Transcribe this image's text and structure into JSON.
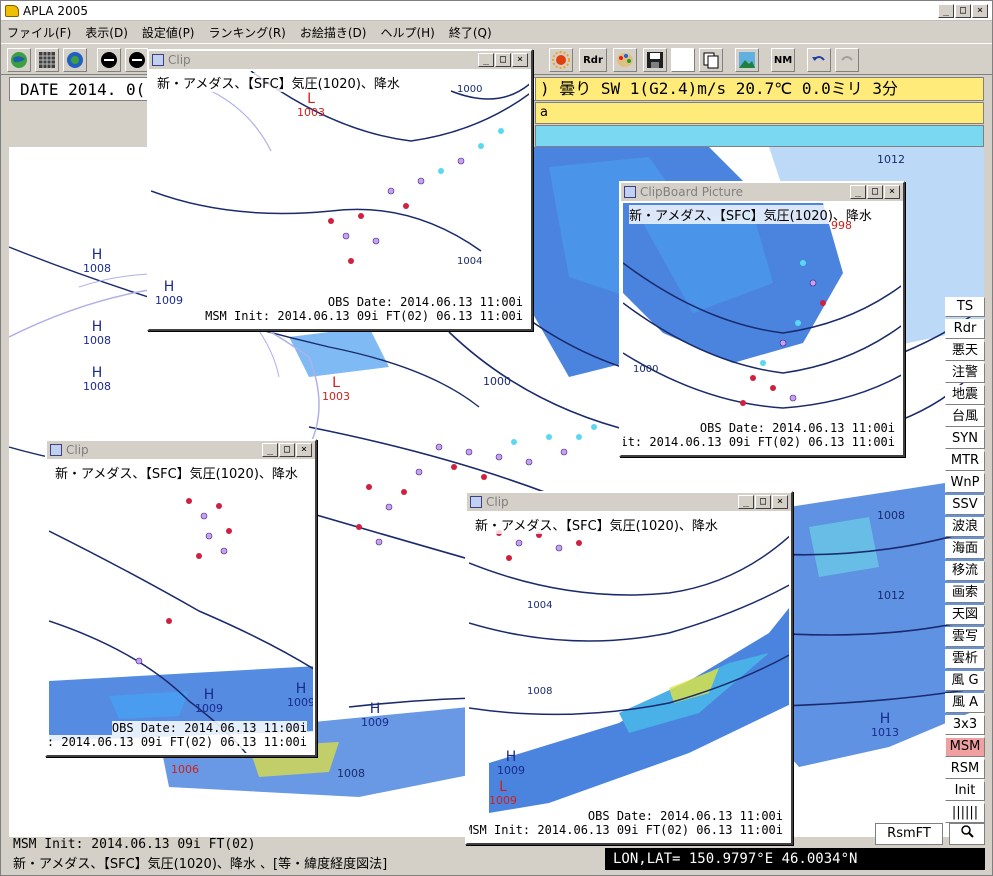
{
  "window": {
    "title": "APLA 2005"
  },
  "menu": [
    "ファイル(F)",
    "表示(D)",
    "設定値(P)",
    "ランキング(R)",
    "お絵描き(D)",
    "ヘルプ(H)",
    "終了(Q)"
  ],
  "toolbar": {
    "rdr": "Rdr",
    "nm": "NM"
  },
  "date_bar": {
    "text": "DATE 2014. 0("
  },
  "obs_bar": {
    "text": ") 曇り  SW  1(G2.4)m/s  20.7℃  0.0ミリ  3分",
    "line2": "a"
  },
  "right_panel": [
    "TS",
    "Rdr",
    "悪天",
    "注警",
    "地震",
    "台風",
    "SYN",
    "MTR",
    "WnP",
    "SSV",
    "波浪",
    "海面",
    "移流",
    "画索",
    "天図",
    "雲写",
    "雲析",
    "風 G",
    "風 A",
    "3x3",
    "MSM",
    "RSM",
    "Init",
    "||||||"
  ],
  "active_panel": "MSM",
  "status": {
    "init": "MSM Init: 2014.06.13 09i FT(02)",
    "desc": "新・アメダス、【SFC】気圧(1020)、降水 、[等・緯度経度図法]",
    "lonlat": "LON,LAT= 150.9797°E  46.0034°N",
    "rsmft": "RsmFT"
  },
  "main_labels": {
    "h1008a": "1008",
    "h1008b": "1008",
    "h1008c": "1008",
    "l1003": "1003",
    "i1000": "1000",
    "i1004": "1004",
    "i1012": "1012",
    "i1008r": "1008",
    "h1013": "1013",
    "i1012b": "1012",
    "i1006": "1006",
    "i1008b": "1008",
    "i1009": "1009",
    "H": "H",
    "L": "L"
  },
  "clips": [
    {
      "title": "Clip",
      "head": "新・アメダス、【SFC】気圧(1020)、降水",
      "obs": "OBS Date: 2014.06.13 11:00i",
      "msm": "MSM Init: 2014.06.13 09i FT(02)  06.13 11:00i",
      "labels": {
        "l": "1003",
        "h": "1008",
        "h2": "1009",
        "c1": "1000",
        "c2": "1004"
      }
    },
    {
      "title": "ClipBoard Picture",
      "head": "新・アメダス、【SFC】気圧(1020)、降水",
      "obs": "OBS Date: 2014.06.13 11:00i",
      "msm": "Init: 2014.06.13 09i FT(02)  06.13 11:00i",
      "labels": {
        "c1": "1000",
        "c2": "998"
      }
    },
    {
      "title": "Clip",
      "head": "新・アメダス、【SFC】気圧(1020)、降水",
      "obs": "OBS Date: 2014.06.13 11:00i",
      "msm": "nit: 2014.06.13 09i FT(02)  06.13 11:00i",
      "labels": {
        "h": "1009",
        "h2": "1009"
      }
    },
    {
      "title": "Clip",
      "head": "新・アメダス、【SFC】気圧(1020)、降水",
      "obs": "OBS Date: 2014.06.13 11:00i",
      "msm": "MSM Init: 2014.06.13 09i FT(02)  06.13 11:00i",
      "labels": {
        "c1": "1004",
        "c2": "1008",
        "h": "1009",
        "l": "1009"
      }
    }
  ]
}
